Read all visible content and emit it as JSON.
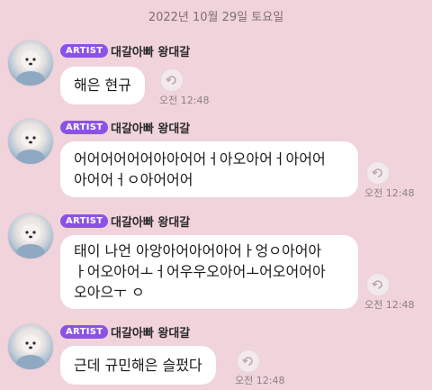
{
  "date_header": "2022년 10월 29일 토요일",
  "messages": [
    {
      "badge": "ARTIST",
      "sender": "대갈아빠 왕대갈",
      "lines": [
        "해은 현규"
      ],
      "time": "오전 12:48",
      "icons": {
        "avatar": "profile-photo-dog",
        "reply": "reply-icon"
      }
    },
    {
      "badge": "ARTIST",
      "sender": "대갈아빠 왕대갈",
      "lines": [
        "어어어어어어아아어어ㅓ아오아어ㅓ아어어",
        "아어어ㅓㅇ아어어어"
      ],
      "time": "오전 12:48",
      "icons": {
        "avatar": "profile-photo-dog",
        "reply": "reply-icon"
      }
    },
    {
      "badge": "ARTIST",
      "sender": "대갈아빠 왕대갈",
      "lines": [
        "태이 나언 아앙아어아어아어ㅏ엉ㅇ아어아",
        "ㅏ어오아어ㅗㅓ어우우오아어ㅗ어오어어아",
        "오아으ㅜ ㅇ"
      ],
      "time": "오전 12:48",
      "icons": {
        "avatar": "profile-photo-dog",
        "reply": "reply-icon"
      }
    },
    {
      "badge": "ARTIST",
      "sender": "대갈아빠 왕대갈",
      "lines": [
        "근데 규민해은 슬펐다"
      ],
      "time": "오전 12:48",
      "icons": {
        "avatar": "profile-photo-dog",
        "reply": "reply-icon"
      }
    }
  ]
}
